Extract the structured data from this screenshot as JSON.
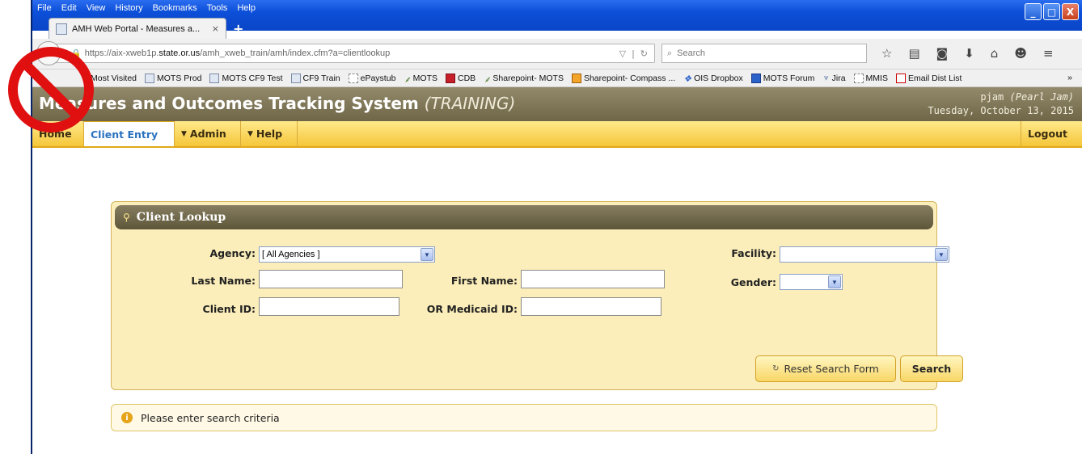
{
  "browser": {
    "menu": [
      "File",
      "Edit",
      "View",
      "History",
      "Bookmarks",
      "Tools",
      "Help"
    ],
    "window_buttons": [
      "_",
      "□",
      "X"
    ],
    "tab_title": "AMH Web Portal - Measures a...",
    "tab_close": "×",
    "new_tab": "+",
    "url_prefix": "https://aix-xweb1p.",
    "url_domain": "state.or.us",
    "url_path": "/amh_xweb_train/amh/index.cfm?a=clientlookup",
    "search_placeholder": "Search",
    "bookmarks": [
      "Most Visited",
      "MOTS Prod",
      "MOTS CF9 Test",
      "CF9 Train",
      "ePaystub",
      "MOTS",
      "CDB",
      "Sharepoint- MOTS",
      "Sharepoint- Compass ...",
      "OIS Dropbox",
      "MOTS Forum",
      "Jira",
      "MMIS",
      "Email Dist List"
    ],
    "bookmarks_more": "»"
  },
  "app": {
    "title": "Measures and Outcomes Tracking System",
    "title_suffix": "(TRAINING)",
    "user": "pjam",
    "user_name": "(Pearl Jam)",
    "date": "Tuesday, October 13, 2015",
    "nav": {
      "home": "Home",
      "client_entry": "Client Entry",
      "admin": "Admin",
      "help": "Help",
      "logout": "Logout"
    }
  },
  "lookup": {
    "header": "Client Lookup",
    "agency_label": "Agency:",
    "agency_value": "[ All Agencies ]",
    "facility_label": "Facility:",
    "facility_value": "",
    "last_name_label": "Last Name:",
    "last_name_value": "",
    "first_name_label": "First Name:",
    "first_name_value": "",
    "gender_label": "Gender:",
    "gender_value": "",
    "client_id_label": "Client ID:",
    "client_id_value": "",
    "medicaid_label": "OR Medicaid ID:",
    "medicaid_value": "",
    "reset_button": "Reset Search Form",
    "search_button": "Search"
  },
  "message": "Please enter search criteria",
  "colors": {
    "header_brown": "#7f7656",
    "nav_yellow": "#f8d55a",
    "panel_bg": "#fbeeba",
    "active_tab_text": "#2a72c0",
    "prohibited_red": "#e01010"
  }
}
